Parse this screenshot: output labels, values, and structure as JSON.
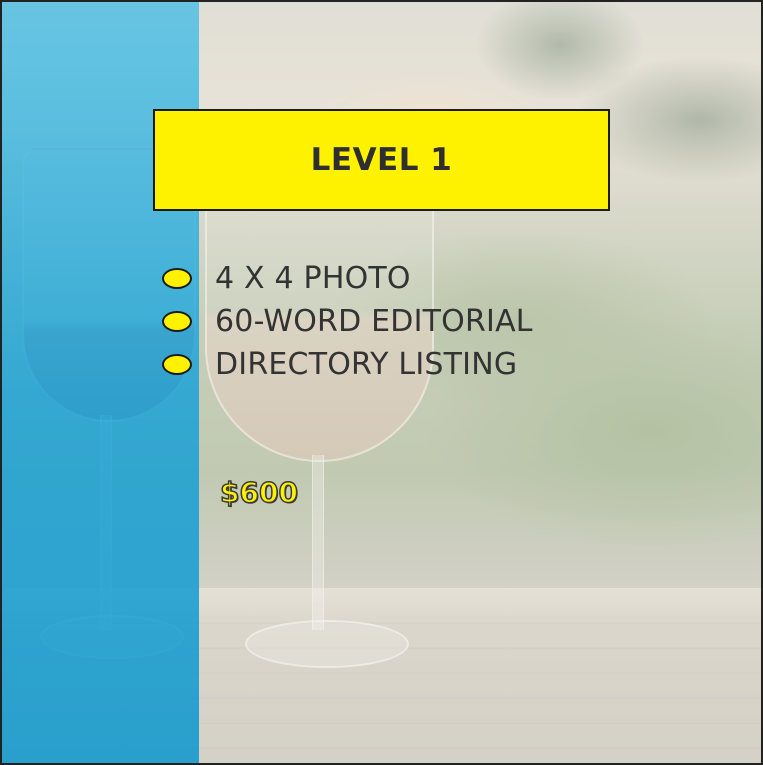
{
  "card": {
    "title": "LEVEL 1",
    "features": [
      "4 X 4 PHOTO",
      "60-WORD EDITORIAL",
      "DIRECTORY LISTING"
    ],
    "price": "$600"
  },
  "colors": {
    "accent_yellow": "#fff200",
    "band_blue": "#14a0d7",
    "border": "#1b1b1b",
    "text": "#333333"
  },
  "background": {
    "icon": "wine-glasses-photo"
  }
}
